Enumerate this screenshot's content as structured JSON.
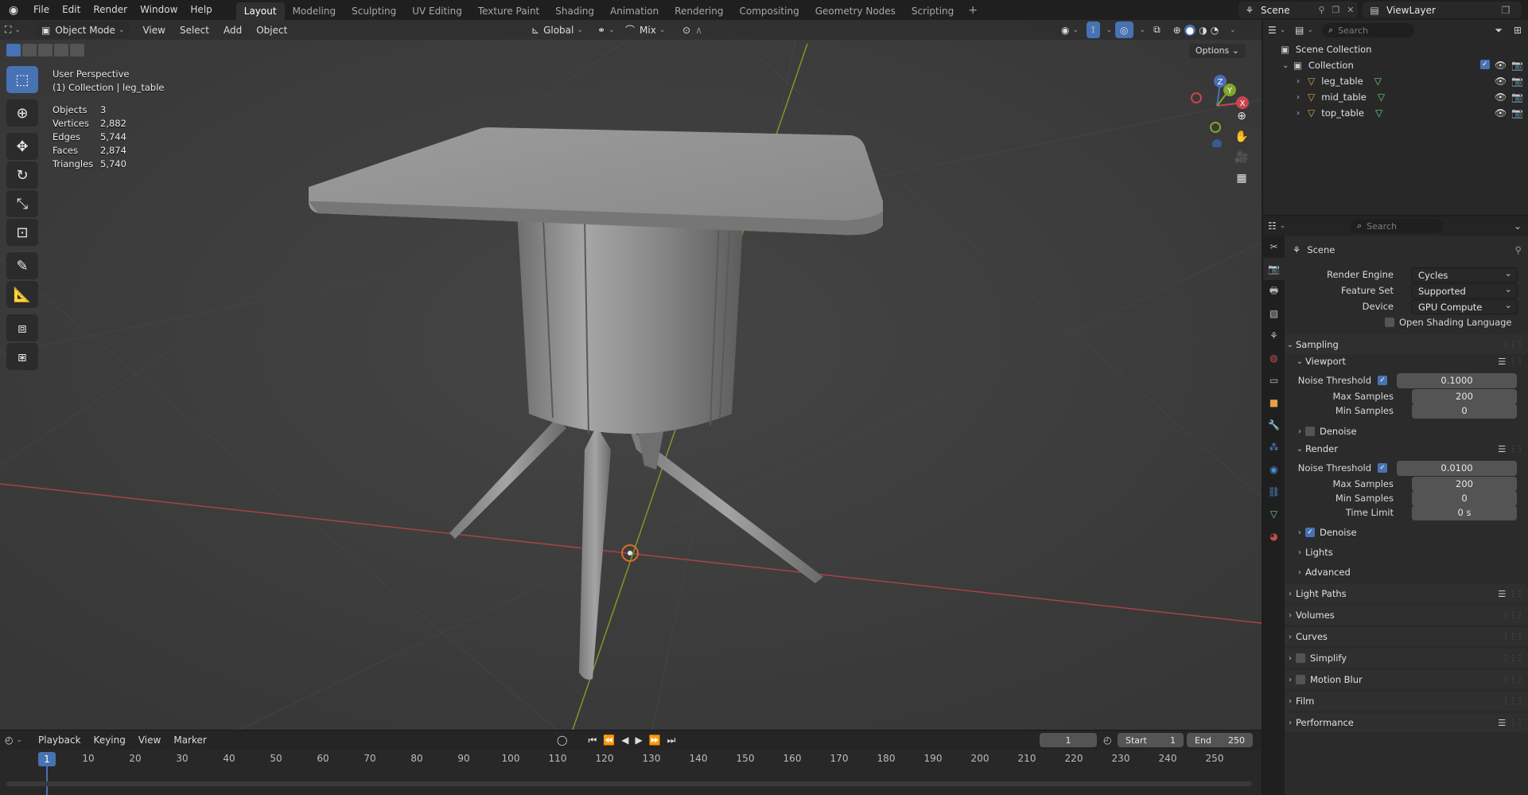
{
  "topbar": {
    "menu": [
      "File",
      "Edit",
      "Render",
      "Window",
      "Help"
    ],
    "workspaces": [
      "Layout",
      "Modeling",
      "Sculpting",
      "UV Editing",
      "Texture Paint",
      "Shading",
      "Animation",
      "Rendering",
      "Compositing",
      "Geometry Nodes",
      "Scripting"
    ],
    "active_workspace": "Layout",
    "add_tab": "+",
    "scene": "Scene",
    "view_layer": "ViewLayer"
  },
  "viewport": {
    "mode": "Object Mode",
    "menus": [
      "View",
      "Select",
      "Add",
      "Object"
    ],
    "orientation": "Global",
    "snap_mode": "Mix",
    "options_label": "Options",
    "perspective_label": "User Perspective",
    "collection_label": "(1) Collection | leg_table",
    "stats": [
      {
        "label": "Objects",
        "value": "3"
      },
      {
        "label": "Vertices",
        "value": "2,882"
      },
      {
        "label": "Edges",
        "value": "5,744"
      },
      {
        "label": "Faces",
        "value": "2,874"
      },
      {
        "label": "Triangles",
        "value": "5,740"
      }
    ],
    "gizmo_axes": {
      "x": "X",
      "y": "Y",
      "z": "Z"
    },
    "colors": {
      "x_axis": "#a8424a",
      "y_axis": "#7b9a27",
      "selection": "#4772b3",
      "background": "#3b3b3b"
    }
  },
  "timeline": {
    "menus": [
      "Playback",
      "Keying",
      "View",
      "Marker"
    ],
    "current_frame": "1",
    "start_label": "Start",
    "start": "1",
    "end_label": "End",
    "end": "250",
    "ticks": [
      "10",
      "20",
      "30",
      "40",
      "50",
      "60",
      "70",
      "80",
      "90",
      "100",
      "110",
      "120",
      "130",
      "140",
      "150",
      "160",
      "170",
      "180",
      "190",
      "200",
      "210",
      "220",
      "230",
      "240",
      "250"
    ],
    "playhead": "1"
  },
  "outliner": {
    "search_placeholder": "Search",
    "scene_collection": "Scene Collection",
    "collection": "Collection",
    "objects": [
      "leg_table",
      "mid_table",
      "top_table"
    ]
  },
  "properties": {
    "search_placeholder": "Search",
    "context": "Scene",
    "render_engine_label": "Render Engine",
    "render_engine": "Cycles",
    "feature_set_label": "Feature Set",
    "feature_set": "Supported",
    "device_label": "Device",
    "device": "GPU Compute",
    "osl_label": "Open Shading Language",
    "sampling": "Sampling",
    "viewport_section": "Viewport",
    "noise_threshold_label": "Noise Threshold",
    "viewport_noise_threshold": "0.1000",
    "max_samples_label": "Max Samples",
    "viewport_max_samples": "200",
    "min_samples_label": "Min Samples",
    "viewport_min_samples": "0",
    "denoise_label": "Denoise",
    "render_section": "Render",
    "render_noise_threshold": "0.0100",
    "render_max_samples": "200",
    "render_min_samples": "0",
    "time_limit_label": "Time Limit",
    "time_limit": "0 s",
    "lights": "Lights",
    "advanced": "Advanced",
    "sections": [
      "Light Paths",
      "Volumes",
      "Curves",
      "Simplify",
      "Motion Blur",
      "Film",
      "Performance"
    ]
  }
}
